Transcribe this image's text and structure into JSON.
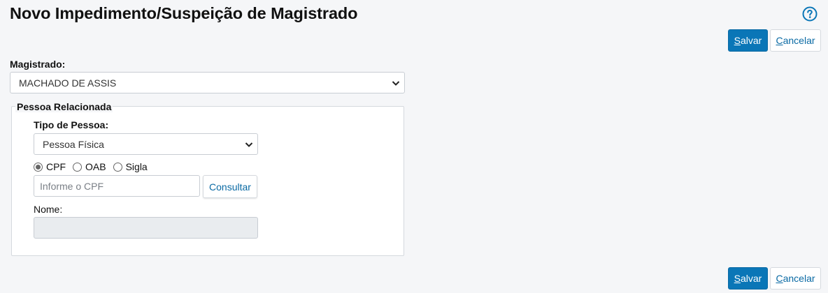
{
  "page": {
    "title": "Novo Impedimento/Suspeição de Magistrado"
  },
  "actions": {
    "save_access_key": "S",
    "save_rest": "alvar",
    "cancel_access_key": "C",
    "cancel_rest": "ancelar"
  },
  "form": {
    "magistrado": {
      "label": "Magistrado:",
      "selected": "MACHADO DE ASSIS"
    },
    "pessoa_relacionada": {
      "legend": "Pessoa Relacionada",
      "tipo_pessoa": {
        "label": "Tipo de Pessoa:",
        "selected": "Pessoa Física"
      },
      "id_type_options": [
        {
          "label": "CPF",
          "checked": true
        },
        {
          "label": "OAB",
          "checked": false
        },
        {
          "label": "Sigla",
          "checked": false
        }
      ],
      "id_input": {
        "placeholder": "Informe o CPF",
        "value": ""
      },
      "consult_button": "Consultar",
      "nome": {
        "label": "Nome:",
        "value": ""
      }
    }
  },
  "colors": {
    "primary": "#0a76b7",
    "link": "#0a6aa4",
    "background": "#f5f6f8"
  },
  "icons": {
    "help": "question-circle-icon",
    "select_arrow": "chevron-down-icon"
  }
}
